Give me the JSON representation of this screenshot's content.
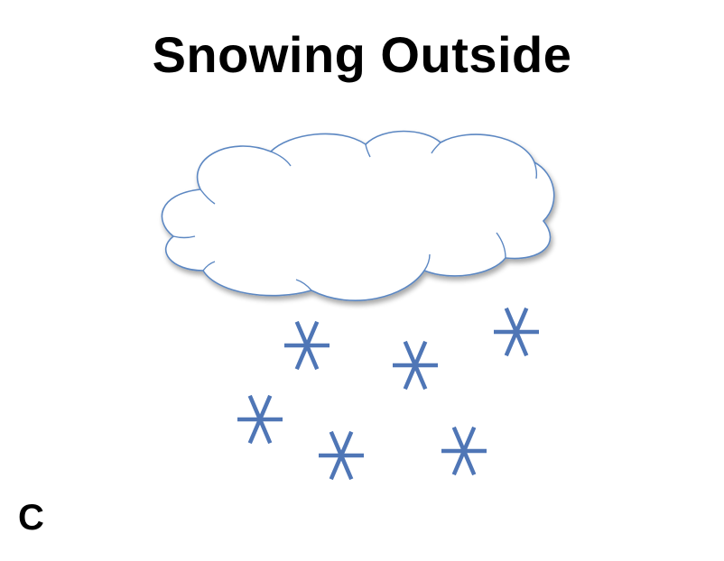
{
  "title": "Snowing Outside",
  "corner_label": "C",
  "colors": {
    "cloud_stroke": "#5b87c2",
    "cloud_fill": "#ffffff",
    "snowflake": "#4f76b6"
  },
  "icons": {
    "cloud": "cloud-icon",
    "snowflake": "snowflake-icon"
  }
}
